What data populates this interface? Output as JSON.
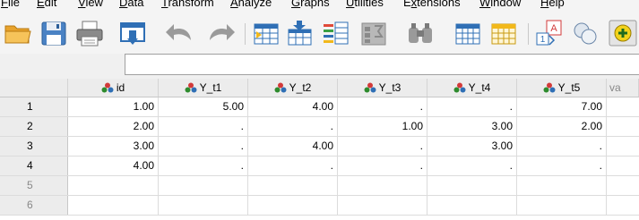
{
  "menu": [
    {
      "pre": "",
      "ul": "F",
      "post": "ile"
    },
    {
      "pre": "",
      "ul": "E",
      "post": "dit"
    },
    {
      "pre": "",
      "ul": "V",
      "post": "iew"
    },
    {
      "pre": "",
      "ul": "D",
      "post": "ata"
    },
    {
      "pre": "",
      "ul": "T",
      "post": "ransform"
    },
    {
      "pre": "",
      "ul": "A",
      "post": "nalyze"
    },
    {
      "pre": "",
      "ul": "G",
      "post": "raphs"
    },
    {
      "pre": "",
      "ul": "U",
      "post": "tilities"
    },
    {
      "pre": "E",
      "ul": "x",
      "post": "tensions"
    },
    {
      "pre": "",
      "ul": "W",
      "post": "indow"
    },
    {
      "pre": "",
      "ul": "H",
      "post": "elp"
    }
  ],
  "toolbar": {
    "icons": [
      "open-folder-icon",
      "save-icon",
      "print-icon",
      "recall-dialog-icon",
      "undo-icon",
      "redo-icon",
      "goto-case-icon",
      "goto-variable-icon",
      "variables-icon",
      "run-descriptives-icon",
      "find-icon",
      "insert-cases-icon",
      "insert-variable-icon",
      "split-file-icon",
      "value-labels-icon",
      "use-sets-icon",
      "spell-check-icon"
    ]
  },
  "cell_editor": {
    "value": ""
  },
  "colors": {
    "accent_green": "#2e8b2e",
    "header_bg": "#ececec"
  },
  "grid": {
    "columns": [
      "id",
      "Y_t1",
      "Y_t2",
      "Y_t3",
      "Y_t4",
      "Y_t5"
    ],
    "partial_column": "va",
    "rows": [
      {
        "num": "1",
        "cells": [
          "1.00",
          "5.00",
          "4.00",
          ".",
          ".",
          "7.00"
        ]
      },
      {
        "num": "2",
        "cells": [
          "2.00",
          ".",
          ".",
          "1.00",
          "3.00",
          "2.00"
        ]
      },
      {
        "num": "3",
        "cells": [
          "3.00",
          ".",
          "4.00",
          ".",
          "3.00",
          "."
        ]
      },
      {
        "num": "4",
        "cells": [
          "4.00",
          ".",
          ".",
          ".",
          ".",
          "."
        ]
      },
      {
        "num": "5",
        "cells": [
          "",
          "",
          "",
          "",
          "",
          ""
        ]
      },
      {
        "num": "6",
        "cells": [
          "",
          "",
          "",
          "",
          "",
          ""
        ]
      }
    ]
  }
}
